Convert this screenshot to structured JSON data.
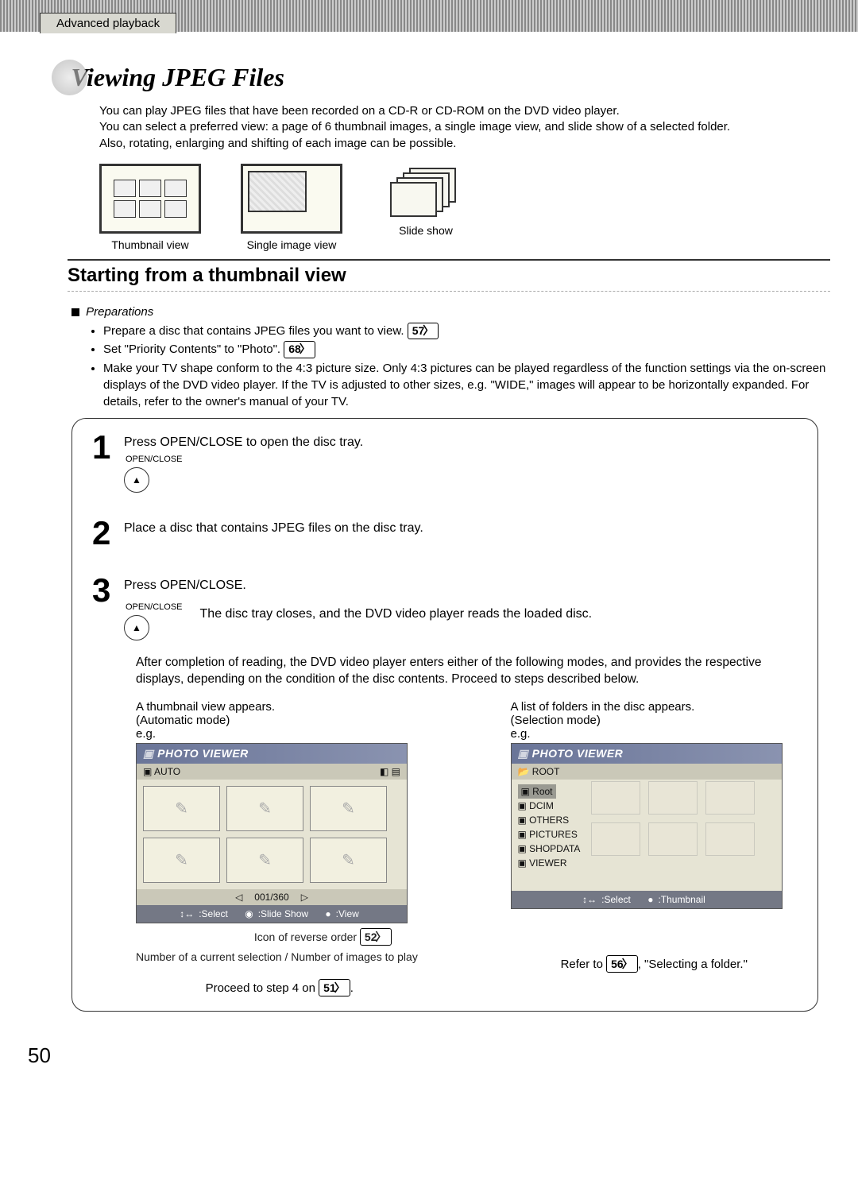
{
  "header_tab": "Advanced playback",
  "title": "Viewing JPEG Files",
  "intro": [
    "You can play JPEG files that have been recorded on a CD-R or CD-ROM on the DVD video player.",
    "You can select a preferred view: a page of 6 thumbnail images, a single image view, and slide show of a selected folder.",
    "Also, rotating, enlarging and shifting of each image can be possible."
  ],
  "views": {
    "thumb": "Thumbnail view",
    "single": "Single image view",
    "slide": "Slide show"
  },
  "section_title": "Starting from a thumbnail view",
  "prep": {
    "heading": "Preparations",
    "items": [
      {
        "text": "Prepare a disc that contains JPEG files you want to view.",
        "ref": "57"
      },
      {
        "text": "Set \"Priority Contents\" to \"Photo\".",
        "ref": "68"
      },
      {
        "text": "Make your TV shape conform to the 4:3 picture size. Only 4:3 pictures can be played regardless of the function settings via the on-screen displays of the DVD video player. If the TV is adjusted to other sizes, e.g. \"WIDE,\" images will appear to be horizontally expanded. For details, refer to the owner's manual of your TV."
      }
    ]
  },
  "steps": {
    "s1": {
      "num": "1",
      "text": "Press OPEN/CLOSE to open the disc tray.",
      "btn": "OPEN/CLOSE"
    },
    "s2": {
      "num": "2",
      "text": "Place a disc that contains JPEG files on the disc tray."
    },
    "s3": {
      "num": "3",
      "text": "Press OPEN/CLOSE.",
      "btn": "OPEN/CLOSE",
      "sub": "The disc tray closes, and the DVD video player reads the loaded disc."
    }
  },
  "after_note": "After completion of reading, the DVD video player enters either of the following modes, and provides the respective displays, depending on the condition of the disc contents. Proceed to steps described below.",
  "modes": {
    "left": {
      "line1": "A thumbnail view appears.",
      "line2": "(Automatic mode)",
      "eg": "e.g.",
      "osd_title": "PHOTO VIEWER",
      "osd_auto": "AUTO",
      "counter": "001/360",
      "foot_select": ":Select",
      "foot_slide": ":Slide Show",
      "foot_view": ":View",
      "annot_icon": "Icon of reverse order",
      "annot_icon_ref": "52",
      "annot_num": "Number of a current selection / Number of images to play",
      "proceed": "Proceed to step 4 on",
      "proceed_ref": "51"
    },
    "right": {
      "line1": "A list of folders in the disc appears.",
      "line2": "(Selection mode)",
      "eg": "e.g.",
      "osd_title": "PHOTO VIEWER",
      "root": "ROOT",
      "folders": [
        "Root",
        "DCIM",
        "OTHERS",
        "PICTURES",
        "SHOPDATA",
        "VIEWER"
      ],
      "foot_select": ":Select",
      "foot_thumb": ":Thumbnail",
      "refer": "Refer to",
      "refer_ref": "56",
      "refer_tail": ", \"Selecting a folder.\""
    }
  },
  "page_num": "50"
}
